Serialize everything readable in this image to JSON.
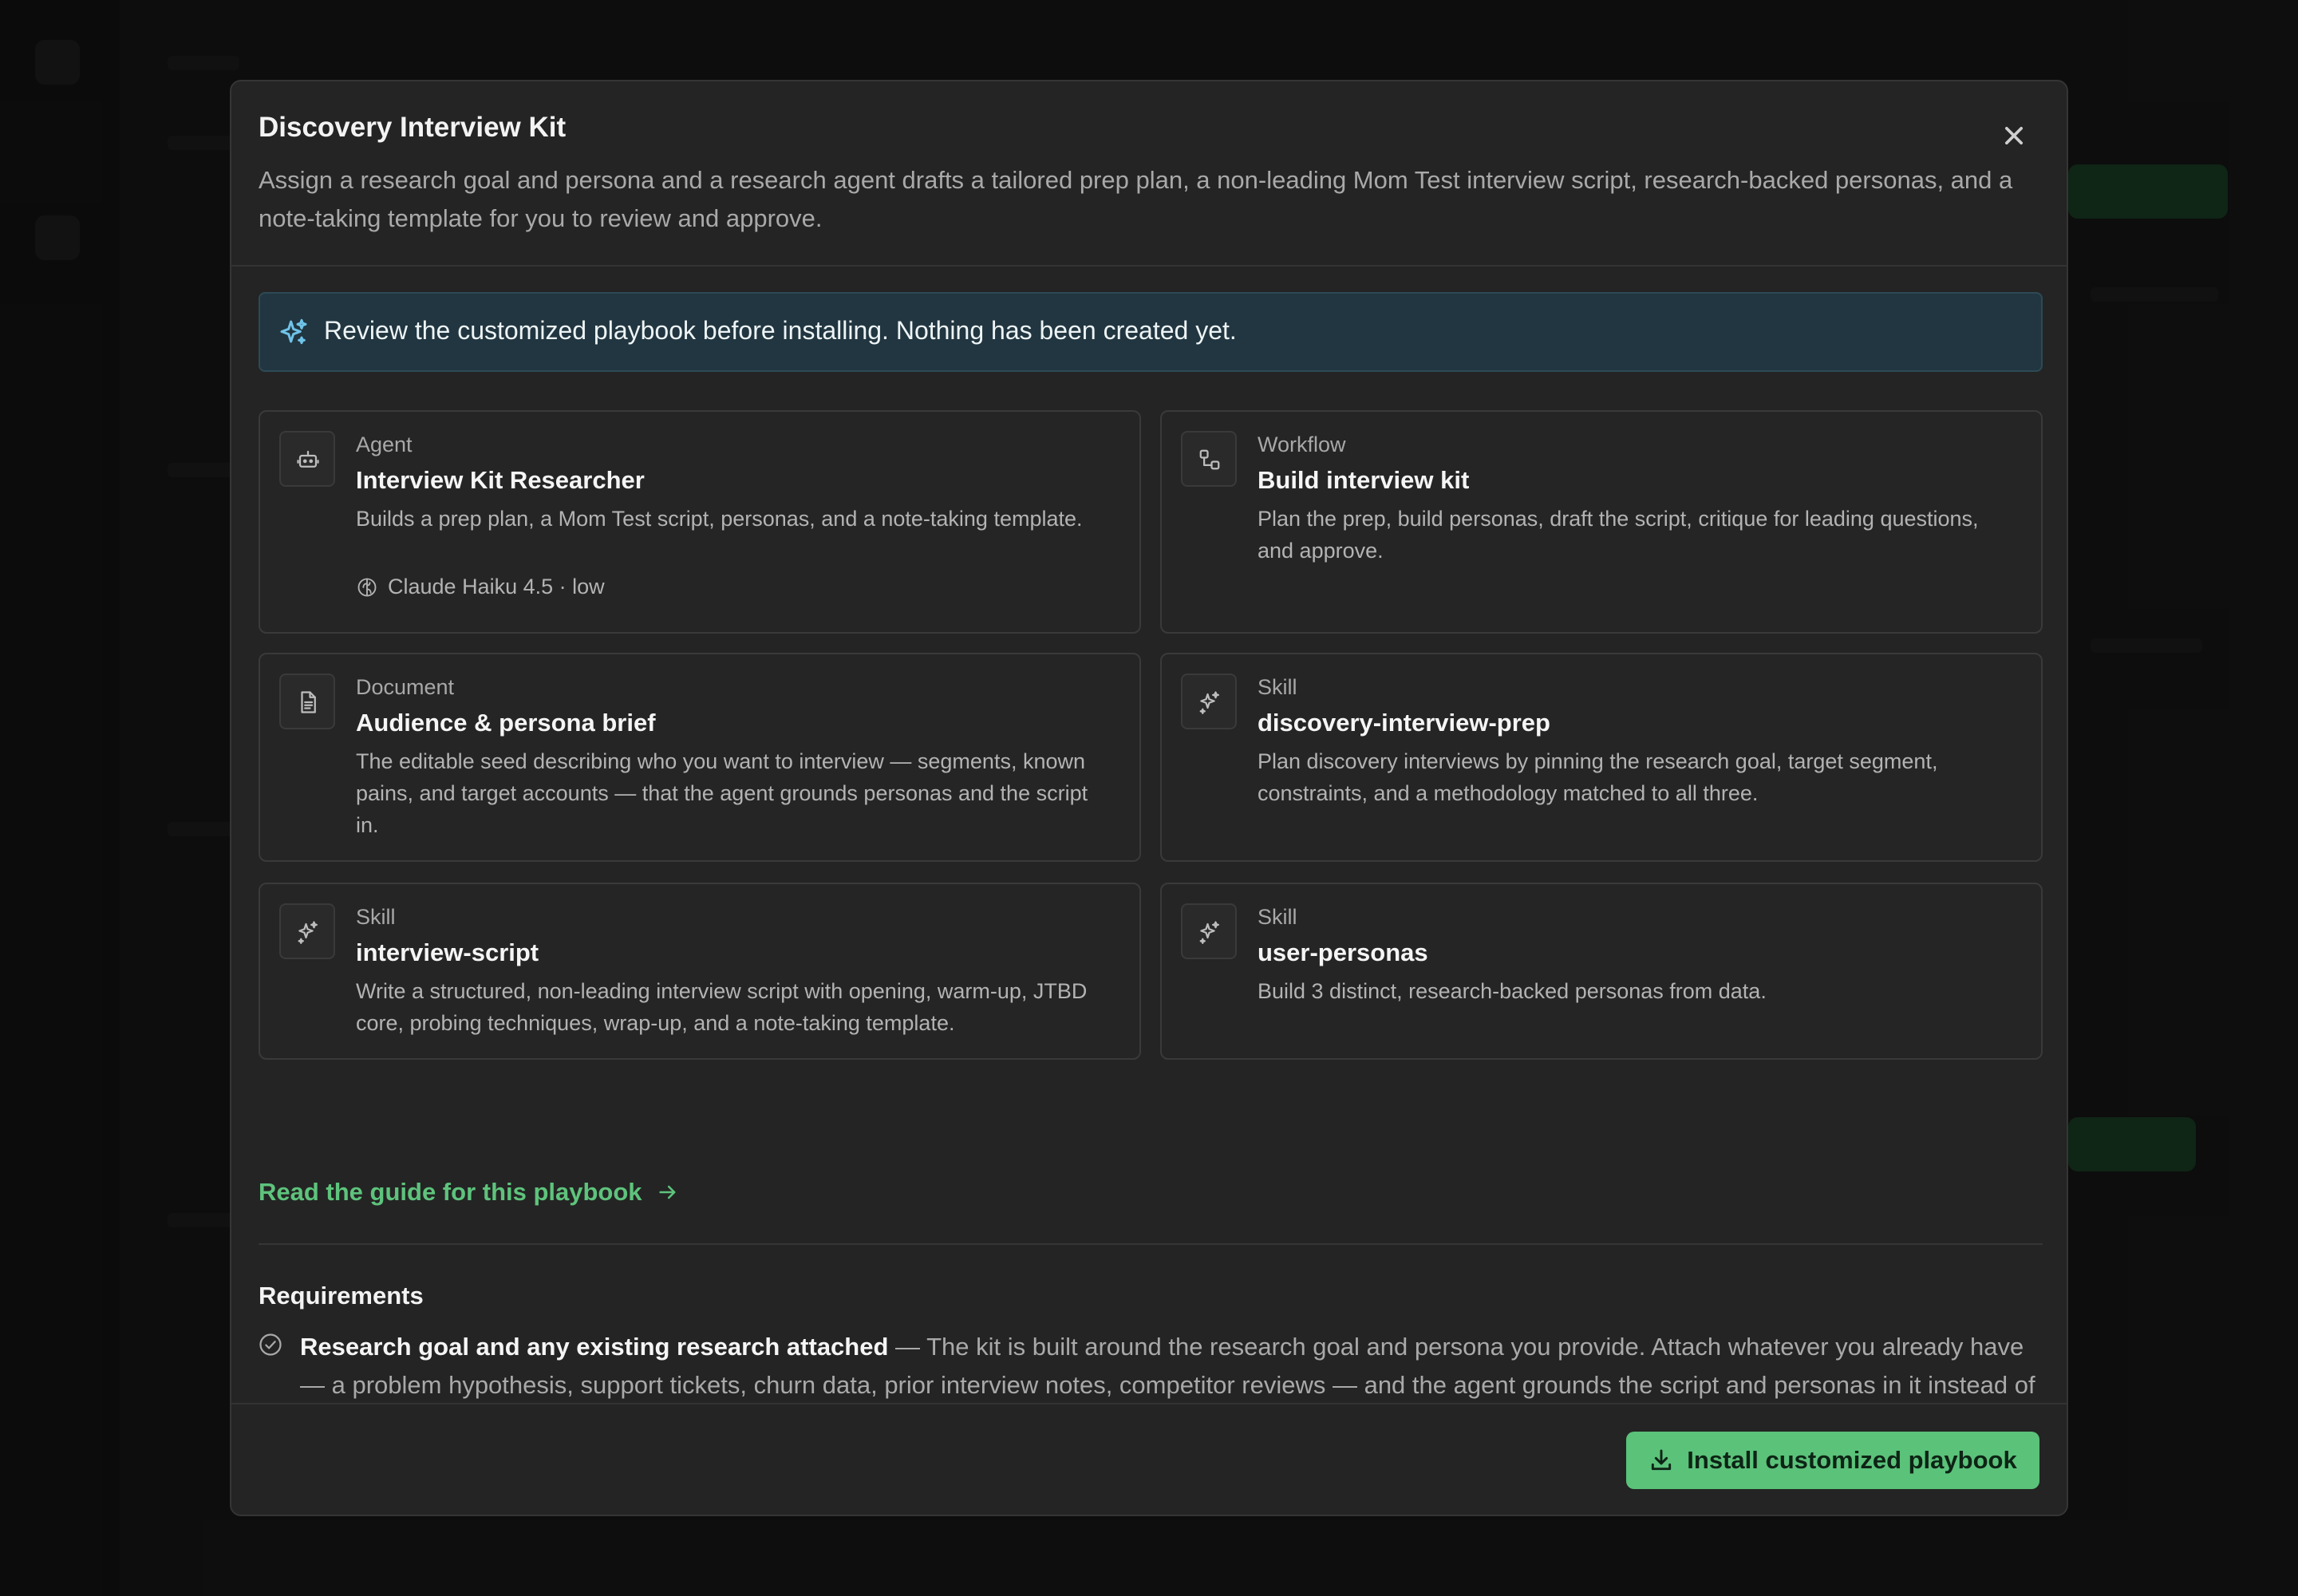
{
  "modal": {
    "title": "Discovery Interview Kit",
    "description": "Assign a research goal and persona and a research agent drafts a tailored prep plan, a non-leading Mom Test interview script, research-backed personas, and a note-taking template for you to review and approve."
  },
  "notice": {
    "text": "Review the customized playbook before installing. Nothing has been created yet."
  },
  "cards": [
    {
      "type": "Agent",
      "name": "Interview Kit Researcher",
      "description": "Builds a prep plan, a Mom Test script, personas, and a note-taking template.",
      "meta": "Claude Haiku 4.5 · low",
      "icon": "robot-icon"
    },
    {
      "type": "Workflow",
      "name": "Build interview kit",
      "description": "Plan the prep, build personas, draft the script, critique for leading questions, and approve.",
      "icon": "workflow-icon"
    },
    {
      "type": "Document",
      "name": "Audience & persona brief",
      "description": "The editable seed describing who you want to interview — segments, known pains, and target accounts — that the agent grounds personas and the script in.",
      "icon": "document-icon"
    },
    {
      "type": "Skill",
      "name": "discovery-interview-prep",
      "description": "Plan discovery interviews by pinning the research goal, target segment, constraints, and a methodology matched to all three.",
      "icon": "sparkle-icon"
    },
    {
      "type": "Skill",
      "name": "interview-script",
      "description": "Write a structured, non-leading interview script with opening, warm-up, JTBD core, probing techniques, wrap-up, and a note-taking template.",
      "icon": "sparkle-icon"
    },
    {
      "type": "Skill",
      "name": "user-personas",
      "description": "Build 3 distinct, research-backed personas from data.",
      "icon": "sparkle-icon"
    }
  ],
  "guide": {
    "label": "Read the guide for this playbook"
  },
  "requirements": {
    "title": "Requirements",
    "items": [
      {
        "strong": "Research goal and any existing research attached",
        "text": " — The kit is built around the research goal and persona you provide. Attach whatever you already have — a problem hypothesis, support tickets, churn data, prior interview notes, competitor reviews — and the agent grounds the script and personas in it instead of inventing them."
      }
    ]
  },
  "footer": {
    "install_label": "Install customized playbook"
  },
  "colors": {
    "accent": "#5bc27a",
    "notice_bg": "#213640",
    "modal_bg": "#242424"
  }
}
